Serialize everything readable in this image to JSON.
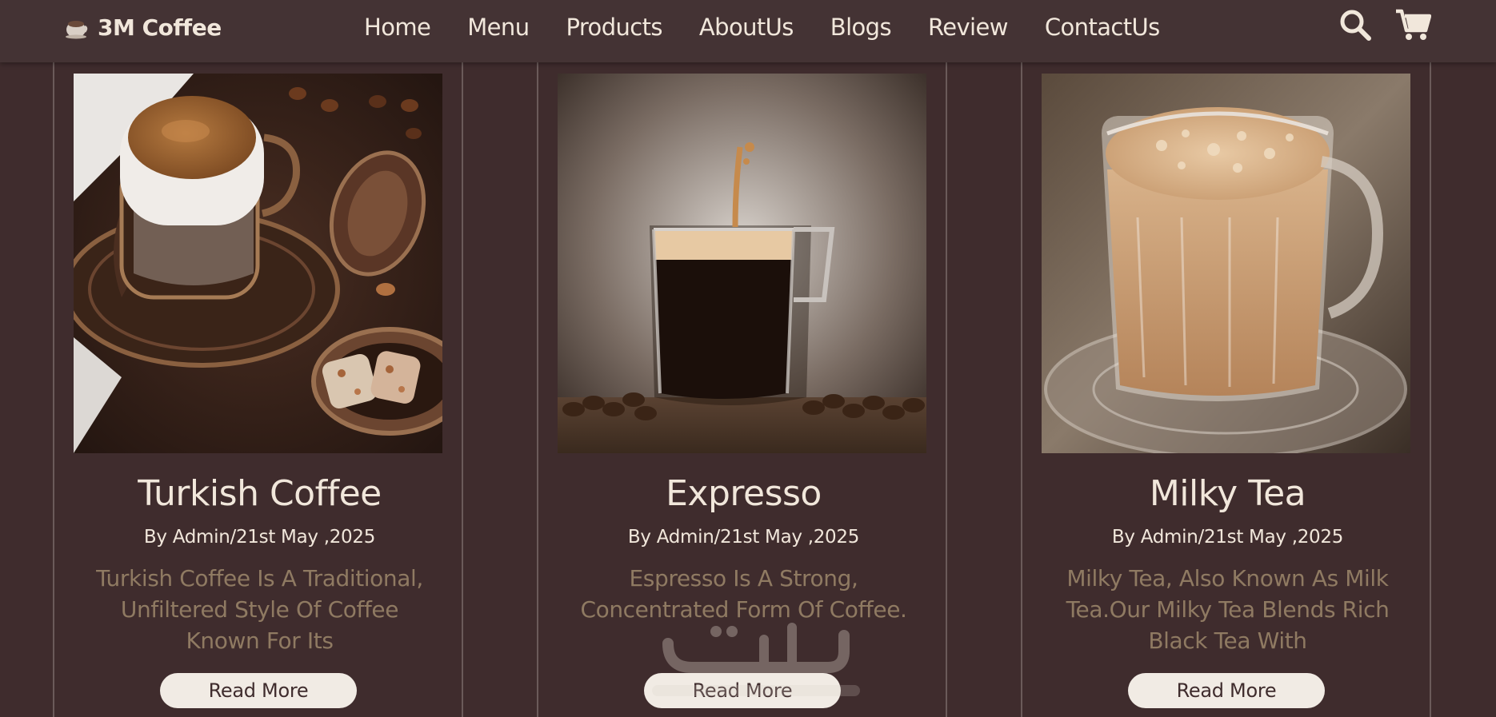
{
  "header": {
    "brand": "3M Coffee",
    "nav": [
      "Home",
      "Menu",
      "Products",
      "AboutUs",
      "Blogs",
      "Review",
      "ContactUs"
    ],
    "icons": [
      "search-icon",
      "cart-icon"
    ]
  },
  "cards": [
    {
      "title": "Turkish Coffee",
      "meta": "By Admin/21st May ,2025",
      "description": "Turkish Coffee Is A Traditional, Unfiltered Style Of Coffee Known For Its",
      "button": "Read More"
    },
    {
      "title": "Expresso",
      "meta": "By Admin/21st May ,2025",
      "description": "Espresso Is A Strong, Concentrated Form Of Coffee.",
      "button": "Read More"
    },
    {
      "title": "Milky Tea",
      "meta": "By Admin/21st May ,2025",
      "description": "Milky Tea, Also Known As Milk Tea.Our Milky Tea Blends Rich Black Tea With",
      "button": "Read More"
    }
  ],
  "colors": {
    "background": "#3f2c2d",
    "header": "#443334",
    "text_light": "#f1e7db",
    "text_muted": "#8f7a62",
    "button_bg": "#f1ebe4"
  }
}
